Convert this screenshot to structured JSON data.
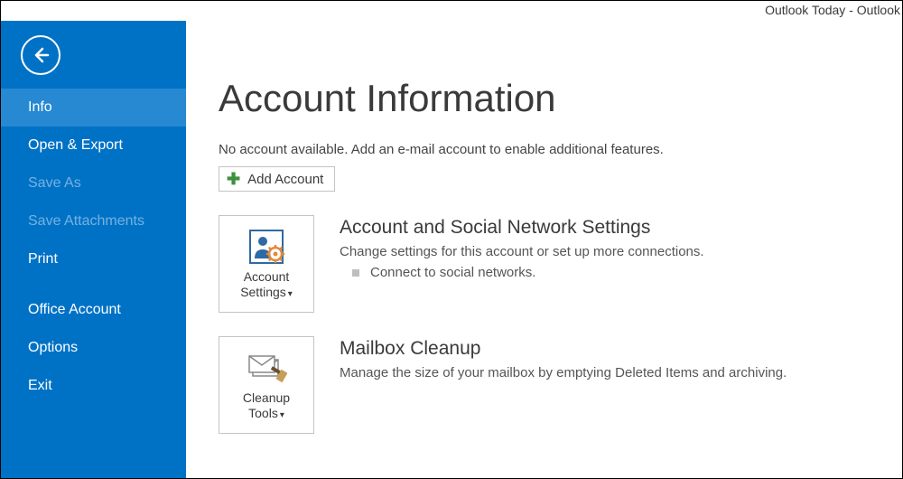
{
  "window": {
    "title": "Outlook Today - Outlook"
  },
  "sidebar": {
    "items": [
      {
        "label": "Info",
        "selected": true,
        "disabled": false
      },
      {
        "label": "Open & Export",
        "selected": false,
        "disabled": false
      },
      {
        "label": "Save As",
        "selected": false,
        "disabled": true
      },
      {
        "label": "Save Attachments",
        "selected": false,
        "disabled": true
      },
      {
        "label": "Print",
        "selected": false,
        "disabled": false
      },
      {
        "label": "Office Account",
        "selected": false,
        "disabled": false
      },
      {
        "label": "Options",
        "selected": false,
        "disabled": false
      },
      {
        "label": "Exit",
        "selected": false,
        "disabled": false
      }
    ]
  },
  "main": {
    "title": "Account Information",
    "subtitle": "No account available. Add an e-mail account to enable additional features.",
    "add_account_label": "Add Account",
    "sections": [
      {
        "tile_line1": "Account",
        "tile_line2": "Settings",
        "has_dropdown": true,
        "icon": "account-settings-icon",
        "title": "Account and Social Network Settings",
        "desc": "Change settings for this account or set up more connections.",
        "bullets": [
          "Connect to social networks."
        ]
      },
      {
        "tile_line1": "Cleanup",
        "tile_line2": "Tools",
        "has_dropdown": true,
        "icon": "cleanup-tools-icon",
        "title": "Mailbox Cleanup",
        "desc": "Manage the size of your mailbox by emptying Deleted Items and archiving.",
        "bullets": []
      }
    ]
  }
}
